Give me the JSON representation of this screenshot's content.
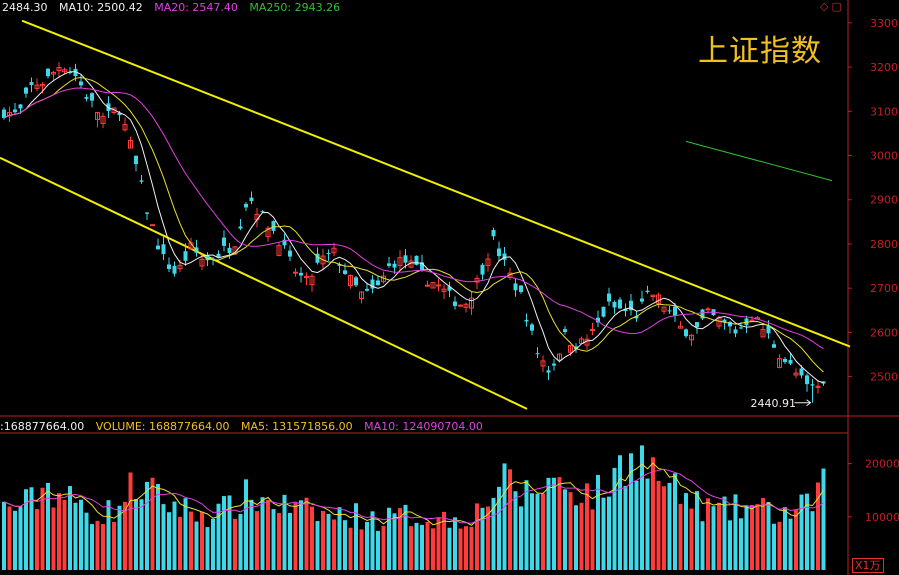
{
  "title": "上证指数",
  "price_header": {
    "close": "2484.30",
    "ma10": "MA10: 2500.42",
    "ma20": "MA20: 2547.40",
    "ma250": "MA250: 2943.26"
  },
  "volume_header": {
    "lead": ":",
    "value": "168877664.00",
    "volume": "VOLUME: 168877664.00",
    "ma5": "MA5: 131571856.00",
    "ma10": "MA10: 124090704.00"
  },
  "low_marker": "2440.91",
  "unit_label": "X1万",
  "icons": [
    "diamond-icon",
    "window-icon"
  ],
  "colors": {
    "up": "#ff3b3b",
    "down": "#3ed8e8",
    "ma10": "#f0f0f0",
    "ma20": "#e8e030",
    "ma60": "#e040e0",
    "ma250": "#30c030",
    "trend": "#f0f000",
    "axis": "#c02020",
    "title": "#f0c020"
  },
  "chart_data": {
    "type": "candlestick",
    "price_axis": {
      "ticks": [
        2500,
        2600,
        2700,
        2800,
        2900,
        3000,
        3100,
        3200,
        3300
      ],
      "range": [
        2400,
        3320
      ]
    },
    "volume_axis": {
      "ticks": [
        10000,
        20000
      ],
      "range": [
        0,
        25000
      ]
    },
    "close_waypoints": [
      3100,
      3090,
      3160,
      3170,
      3210,
      3180,
      3120,
      3080,
      3110,
      3000,
      2870,
      2770,
      2730,
      2790,
      2760,
      2780,
      2800,
      2910,
      2860,
      2820,
      2750,
      2710,
      2760,
      2780,
      2720,
      2680,
      2700,
      2760,
      2760,
      2730,
      2710,
      2680,
      2660,
      2720,
      2810,
      2740,
      2680,
      2560,
      2510,
      2590,
      2570,
      2600,
      2660,
      2650,
      2640,
      2690,
      2660,
      2610,
      2600,
      2640,
      2620,
      2600,
      2640,
      2600,
      2550,
      2510,
      2470,
      2484.3
    ],
    "volume_waypoints": [
      11500,
      12000,
      13000,
      16000,
      14000,
      12500,
      11000,
      10500,
      12000,
      16000,
      15000,
      13000,
      12000,
      11000,
      10500,
      11000,
      12000,
      14000,
      13000,
      12500,
      11500,
      11000,
      10500,
      10000,
      10500,
      10000,
      9500,
      9800,
      10200,
      10000,
      9800,
      9500,
      10000,
      11000,
      15000,
      16500,
      14000,
      15000,
      17000,
      16000,
      15000,
      14000,
      15500,
      20000,
      22000,
      19000,
      16000,
      14000,
      12500,
      11500,
      11000,
      11500,
      12000,
      11000,
      10500,
      11000,
      12000,
      16877.8
    ],
    "low_marker_value": 2440.91,
    "trend_lines": [
      {
        "name": "upper-channel",
        "from": [
          "start",
          3310
        ],
        "to": [
          "end",
          2565
        ]
      },
      {
        "name": "lower-channel",
        "from": [
          "start",
          2995
        ],
        "to": [
          "mid",
          2425
        ]
      }
    ],
    "ma250_segment": {
      "from": 3032,
      "to": 2943.26
    },
    "xlabel": "",
    "ylabel": ""
  }
}
